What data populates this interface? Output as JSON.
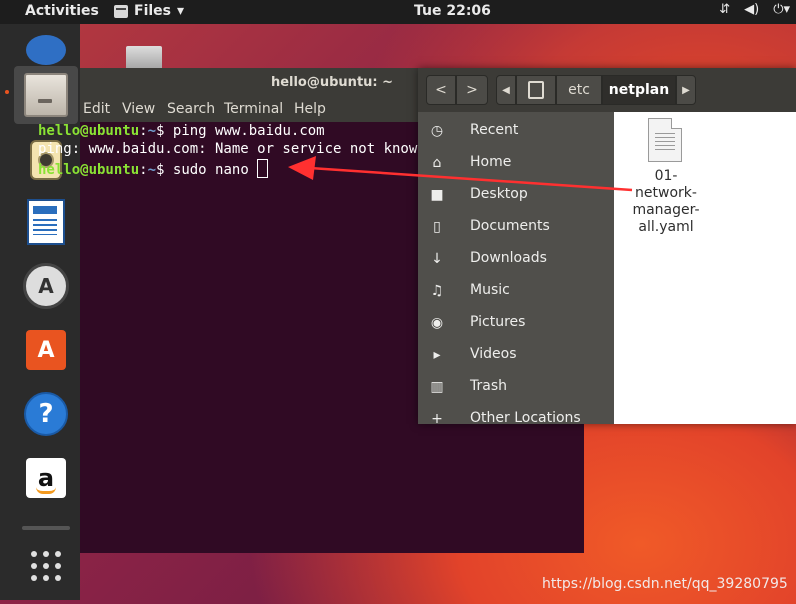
{
  "topbar": {
    "activities": "Activities",
    "app_menu": "Files",
    "app_menu_arrow": "▾",
    "clock": "Tue 22:06",
    "status_icons": [
      "network-icon",
      "volume-icon",
      "power-icon"
    ]
  },
  "dock": {
    "items": [
      "files-icon",
      "rhythmbox-icon",
      "writer-icon",
      "software-updater-icon",
      "software-store-icon",
      "help-icon",
      "amazon-icon",
      "show-apps-icon"
    ],
    "help_glyph": "?",
    "amazon_glyph": "a",
    "updater_glyph": "A",
    "store_glyph": "A"
  },
  "terminal": {
    "title": "hello@ubuntu: ~",
    "menu": [
      "Edit",
      "View",
      "Search",
      "Terminal",
      "Help"
    ],
    "lines": [
      {
        "user": "hello@ubuntu",
        "sep": ":",
        "path": "~",
        "cmd": "$ ping www.baidu.com"
      },
      {
        "output": "ping: www.baidu.com: Name or service not known"
      },
      {
        "user": "hello@ubuntu",
        "sep": ":",
        "path": "~",
        "cmd": "$ sudo nano "
      }
    ]
  },
  "files": {
    "path_segments": [
      "etc",
      "netplan"
    ],
    "sidebar": [
      {
        "icon": "clock-icon",
        "glyph": "◷",
        "label": "Recent"
      },
      {
        "icon": "home-icon",
        "glyph": "⌂",
        "label": "Home"
      },
      {
        "icon": "folder-icon",
        "glyph": "■",
        "label": "Desktop"
      },
      {
        "icon": "document-icon",
        "glyph": "▯",
        "label": "Documents"
      },
      {
        "icon": "download-icon",
        "glyph": "↓",
        "label": "Downloads"
      },
      {
        "icon": "music-icon",
        "glyph": "♫",
        "label": "Music"
      },
      {
        "icon": "camera-icon",
        "glyph": "◉",
        "label": "Pictures"
      },
      {
        "icon": "video-icon",
        "glyph": "▸",
        "label": "Videos"
      },
      {
        "icon": "trash-icon",
        "glyph": "▥",
        "label": "Trash"
      },
      {
        "icon": "other-locations-icon",
        "glyph": "+",
        "label": "Other Locations"
      }
    ],
    "files_list": [
      {
        "name_lines": [
          "01-",
          "network-",
          "manager-",
          "all.yaml"
        ]
      }
    ]
  },
  "watermark": "https://blog.csdn.net/qq_39280795",
  "colors": {
    "terminal_bg": "#300a24",
    "user_color": "#8ae234",
    "path_color": "#729fcf",
    "accent": "#e95420",
    "arrow": "#ff3030"
  }
}
